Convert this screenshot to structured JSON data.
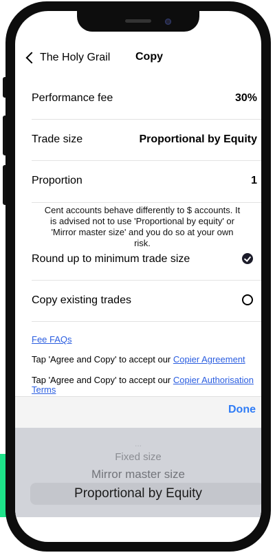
{
  "nav": {
    "back_label": "The Holy Grail",
    "title": "Copy"
  },
  "settings": [
    {
      "label": "Performance fee",
      "value": "30%"
    },
    {
      "label": "Trade size",
      "value": "Proportional by Equity"
    },
    {
      "label": "Proportion",
      "value": "1"
    }
  ],
  "notice": "Cent accounts behave differently to $ accounts. It is advised not to use 'Proportional by equity' or 'Mirror master size' and you do so at your own risk.",
  "toggles": {
    "round_up": {
      "label": "Round up to minimum trade size",
      "checked": true
    },
    "copy_existing": {
      "label": "Copy existing trades",
      "checked": false
    }
  },
  "links": {
    "fee_faqs": "Fee FAQs",
    "agree_prefix_1": "Tap 'Agree and Copy' to accept our ",
    "copier_agreement": "Copier Agreement",
    "agree_prefix_2": "Tap 'Agree and Copy' to accept our ",
    "copier_authorisation": "Copier Authorisation Terms"
  },
  "picker": {
    "done_label": "Done",
    "options": [
      "...",
      "Fixed size",
      "Mirror master size",
      "Proportional by Equity"
    ],
    "selected": "Proportional by Equity"
  },
  "colors": {
    "accent_green": "#1ee38a",
    "link_blue": "#2a5de0",
    "done_blue": "#2f7cf6",
    "picker_bg": "#d1d3d9"
  }
}
